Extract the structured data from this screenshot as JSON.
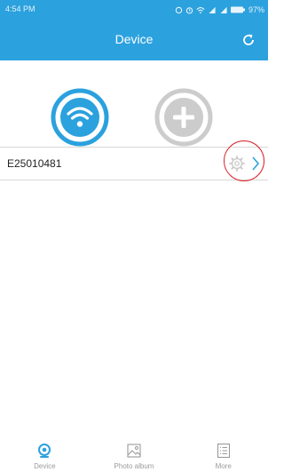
{
  "status_bar": {
    "time": "4:54 PM",
    "battery": "97%"
  },
  "header": {
    "title": "Device"
  },
  "actions": {
    "wifi": "wifi-icon",
    "add": "plus-icon"
  },
  "devices": [
    {
      "name": "E25010481"
    }
  ],
  "nav": [
    {
      "label": "Device",
      "icon": "camera-icon",
      "active": true
    },
    {
      "label": "Photo album",
      "icon": "image-icon",
      "active": false
    },
    {
      "label": "More",
      "icon": "list-icon",
      "active": false
    }
  ],
  "colors": {
    "accent": "#2ba1de",
    "highlight": "#d8232a",
    "inactive": "#cccccc"
  }
}
